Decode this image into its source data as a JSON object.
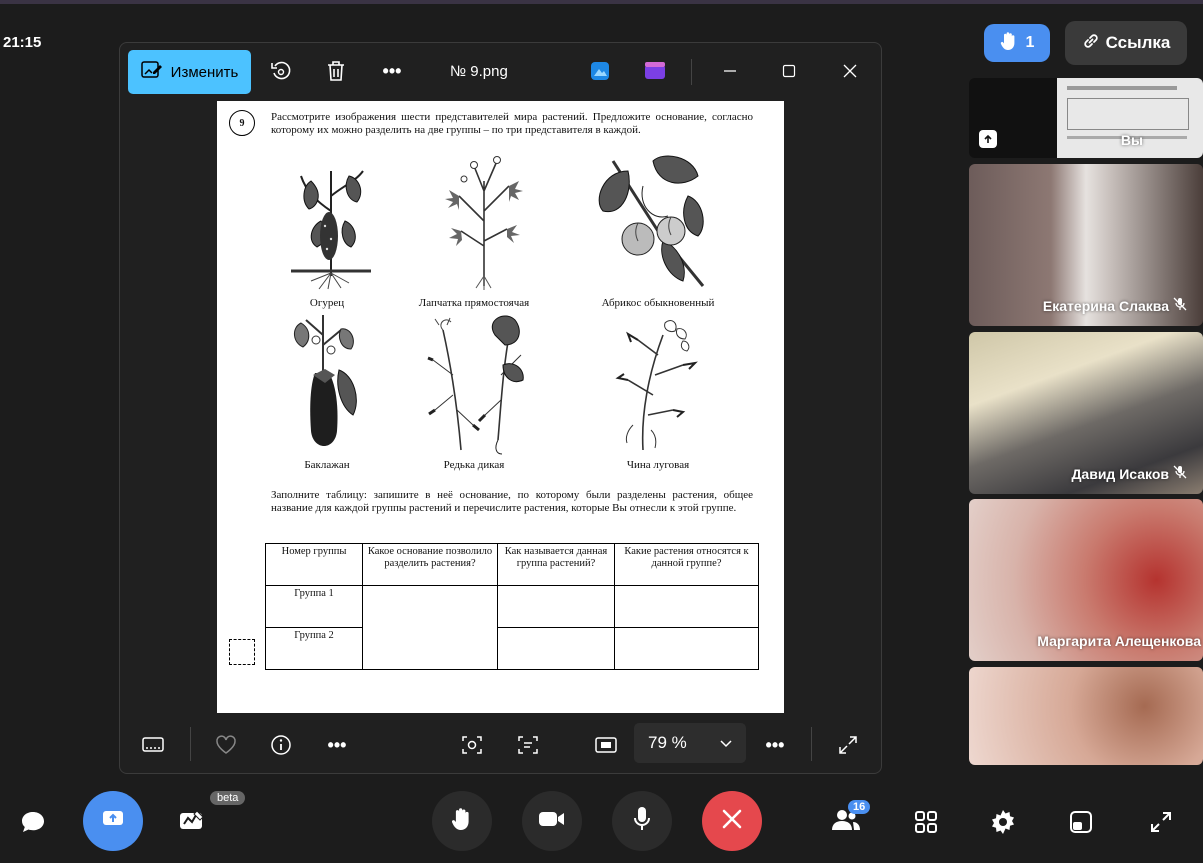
{
  "clock": "21:15",
  "top_right": {
    "hand_count": "1",
    "link_label": "Ссылка"
  },
  "viewer": {
    "edit_label": "Изменить",
    "file_name": "№ 9.png",
    "zoom": "79 %"
  },
  "document": {
    "question_number": "9",
    "question_text": "Рассмотрите изображения шести представителей мира растений. Предложите основание, согласно которому их можно разделить на две группы – по три представителя в каждой.",
    "plants": [
      {
        "label": "Огурец",
        "icon": "cucumber-plant"
      },
      {
        "label": "Лапчатка прямостоячая",
        "icon": "cinquefoil-plant"
      },
      {
        "label": "Абрикос обыкновенный",
        "icon": "apricot-plant"
      },
      {
        "label": "Баклажан",
        "icon": "eggplant-plant"
      },
      {
        "label": "Редька дикая",
        "icon": "wild-radish-plant"
      },
      {
        "label": "Чина луговая",
        "icon": "meadow-pea-plant"
      }
    ],
    "fill_text": "Заполните таблицу: запишите в неё основание, по которому были разделены растения, общее название для каждой группы растений и перечислите растения, которые Вы отнесли к этой группе.",
    "table_headers": [
      "Номер группы",
      "Какое основание позволило разделить растения?",
      "Как называется данная группа растений?",
      "Какие растения относятся к данной группе?"
    ],
    "groups": [
      "Группа 1",
      "Группа 2"
    ]
  },
  "participants": [
    {
      "name": "Вы"
    },
    {
      "name": "Екатерина Слаква"
    },
    {
      "name": "Давид Исаков"
    },
    {
      "name": "Маргарита Алещенкова"
    },
    {
      "name": ""
    }
  ],
  "bottom_bar": {
    "beta_label": "beta",
    "participants_count": "16"
  },
  "colors": {
    "accent": "#4a8ff0",
    "edit": "#4cc2ff",
    "hangup": "#e5484d"
  }
}
